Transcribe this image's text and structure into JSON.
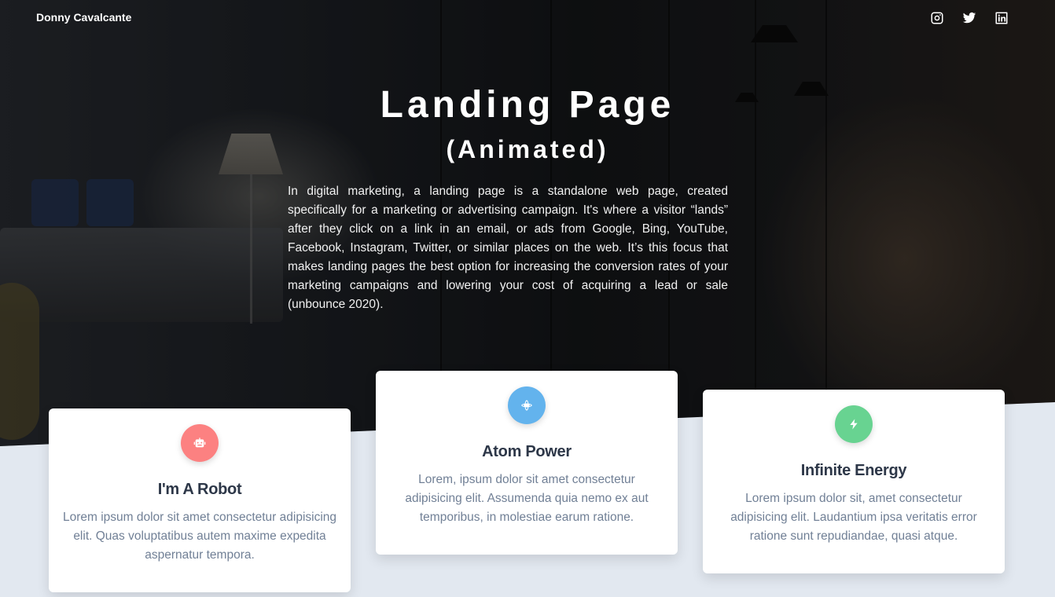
{
  "header": {
    "brand": "Donny Cavalcante",
    "social": [
      {
        "name": "instagram-icon"
      },
      {
        "name": "twitter-icon"
      },
      {
        "name": "linkedin-icon"
      }
    ]
  },
  "hero": {
    "title": "Landing Page",
    "subtitle": "(Animated)",
    "intro": "In digital marketing, a landing page is a standalone web page, created specifically for a marketing or advertising campaign. It's where a visitor “lands” after they click on a link in an email, or ads from Google, Bing, YouTube, Facebook, Instagram, Twitter, or similar places on the web. It’s this focus that makes landing pages the best option for increasing the conversion rates of your marketing campaigns and lowering your cost of acquiring a lead or sale (unbounce 2020)."
  },
  "cards": [
    {
      "icon": "robot-icon",
      "color": "#fc8181",
      "title": "I'm A Robot",
      "text": "Lorem ipsum dolor sit amet consectetur adipisicing elit. Quas voluptatibus autem maxime expedita aspernatur tempora."
    },
    {
      "icon": "atom-icon",
      "color": "#63b3ed",
      "title": "Atom Power",
      "text": "Lorem, ipsum dolor sit amet consectetur adipisicing elit. Assumenda quia nemo ex aut temporibus, in molestiae earum ratione."
    },
    {
      "icon": "bolt-icon",
      "color": "#68d391",
      "title": "Infinite Energy",
      "text": "Lorem ipsum dolor sit, amet consectetur adipisicing elit. Laudantium ipsa veritatis error ratione sunt repudiandae, quasi atque."
    }
  ]
}
